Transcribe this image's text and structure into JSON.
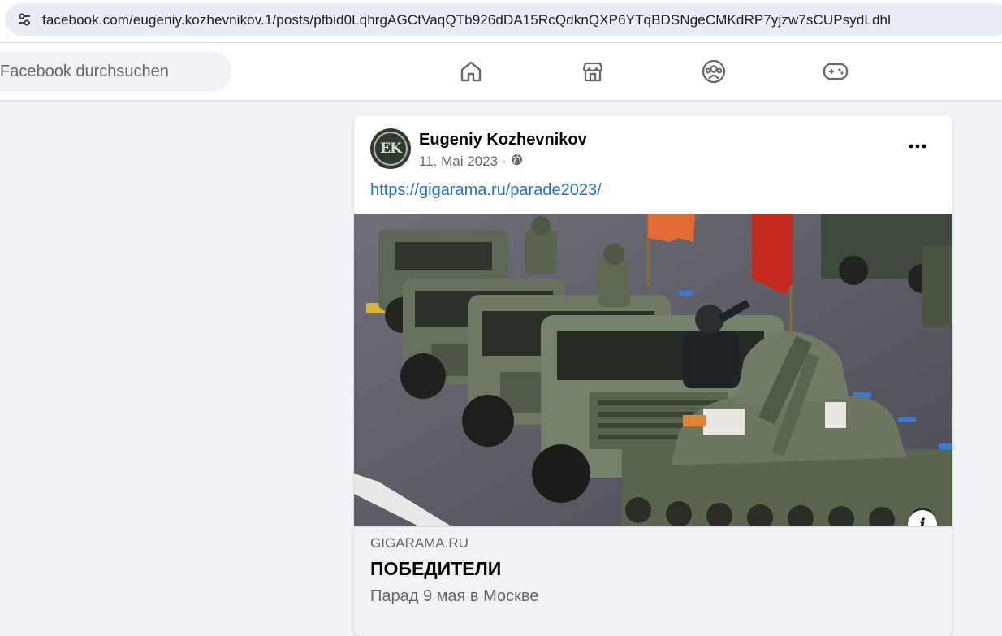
{
  "browser": {
    "url": "facebook.com/eugeniy.kozhevnikov.1/posts/pfbid0LqhrgAGCtVaqQTb926dDA15RcQdknQXP6YTqBDSNgeCMKdRP7yjzw7sCUPsydLdhl",
    "site_info_icon": "tune-icon"
  },
  "header": {
    "search_placeholder": "Facebook durchsuchen",
    "nav": [
      {
        "icon": "home-icon"
      },
      {
        "icon": "marketplace-icon"
      },
      {
        "icon": "groups-icon"
      },
      {
        "icon": "gaming-icon"
      }
    ]
  },
  "post": {
    "avatar_initials": "EK",
    "author": "Eugeniy Kozhevnikov",
    "date": "11. Mai 2023",
    "separator": "·",
    "privacy_icon": "globe-icon",
    "more_icon": "more-horizontal-icon",
    "link_text": "https://gigarama.ru/parade2023/",
    "image_info": "i",
    "preview": {
      "domain": "GIGARAMA.RU",
      "title": "ПОБЕДИТЕЛИ",
      "description": "Парад 9 мая в Москве"
    }
  },
  "colors": {
    "page_bg": "#f0f2f5",
    "card_bg": "#ffffff",
    "link": "#216fdb",
    "secondary_text": "#65676b",
    "icon": "#65676b"
  }
}
